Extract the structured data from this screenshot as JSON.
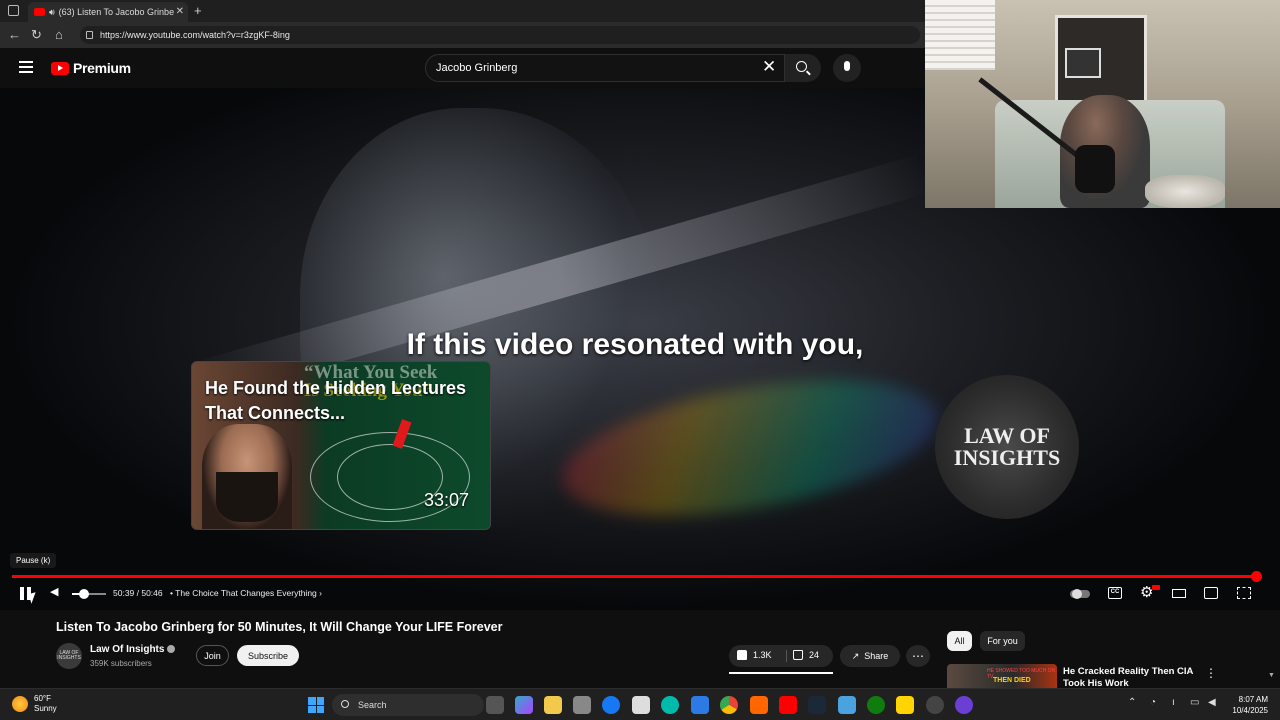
{
  "browser": {
    "tab_title": "(63) Listen To Jacobo Grinbe",
    "url": "https://www.youtube.com/watch?v=r3zgKF-8ing"
  },
  "youtube": {
    "logo_text": "Premium",
    "search_value": "Jacobo Grinberg"
  },
  "video": {
    "caption": "If this video resonated with you,",
    "card_title": "He Found the Hidden Lectures That Connects...",
    "card_quote_line1": "“What You Seek",
    "card_quote_line2": "Is Seeking You”",
    "card_duration": "33:07",
    "watermark_line1": "LAW OF",
    "watermark_line2": "INSIGHTS",
    "tooltip": "Pause (k)",
    "time": "50:39 / 50:46",
    "chapter": "• The Choice That Changes Everything",
    "progress": 0.998
  },
  "details": {
    "title": "Listen To Jacobo Grinberg for 50 Minutes, It Will Change Your LIFE Forever",
    "channel": "Law Of Insights",
    "avatar_text": "LAW OF INSIGHTS",
    "subscribers": "359K subscribers",
    "join": "Join",
    "subscribe": "Subscribe",
    "likes": "1.3K",
    "dislikes": "24",
    "share": "Share"
  },
  "sidebar": {
    "chips": [
      "All",
      "For you"
    ],
    "rec_title": "He Cracked Reality Then CIA Took His Work",
    "rec_thumb_text": "THEN DIED",
    "rec_thumb_top": "HE SHOWED TOO MUCH ON TV"
  },
  "taskbar": {
    "weather_temp": "60°F",
    "weather_desc": "Sunny",
    "search": "Search",
    "time": "8:07 AM",
    "date": "10/4/2025"
  },
  "colors": {
    "accent": "#ff0000",
    "bg": "#0f0f0f"
  }
}
